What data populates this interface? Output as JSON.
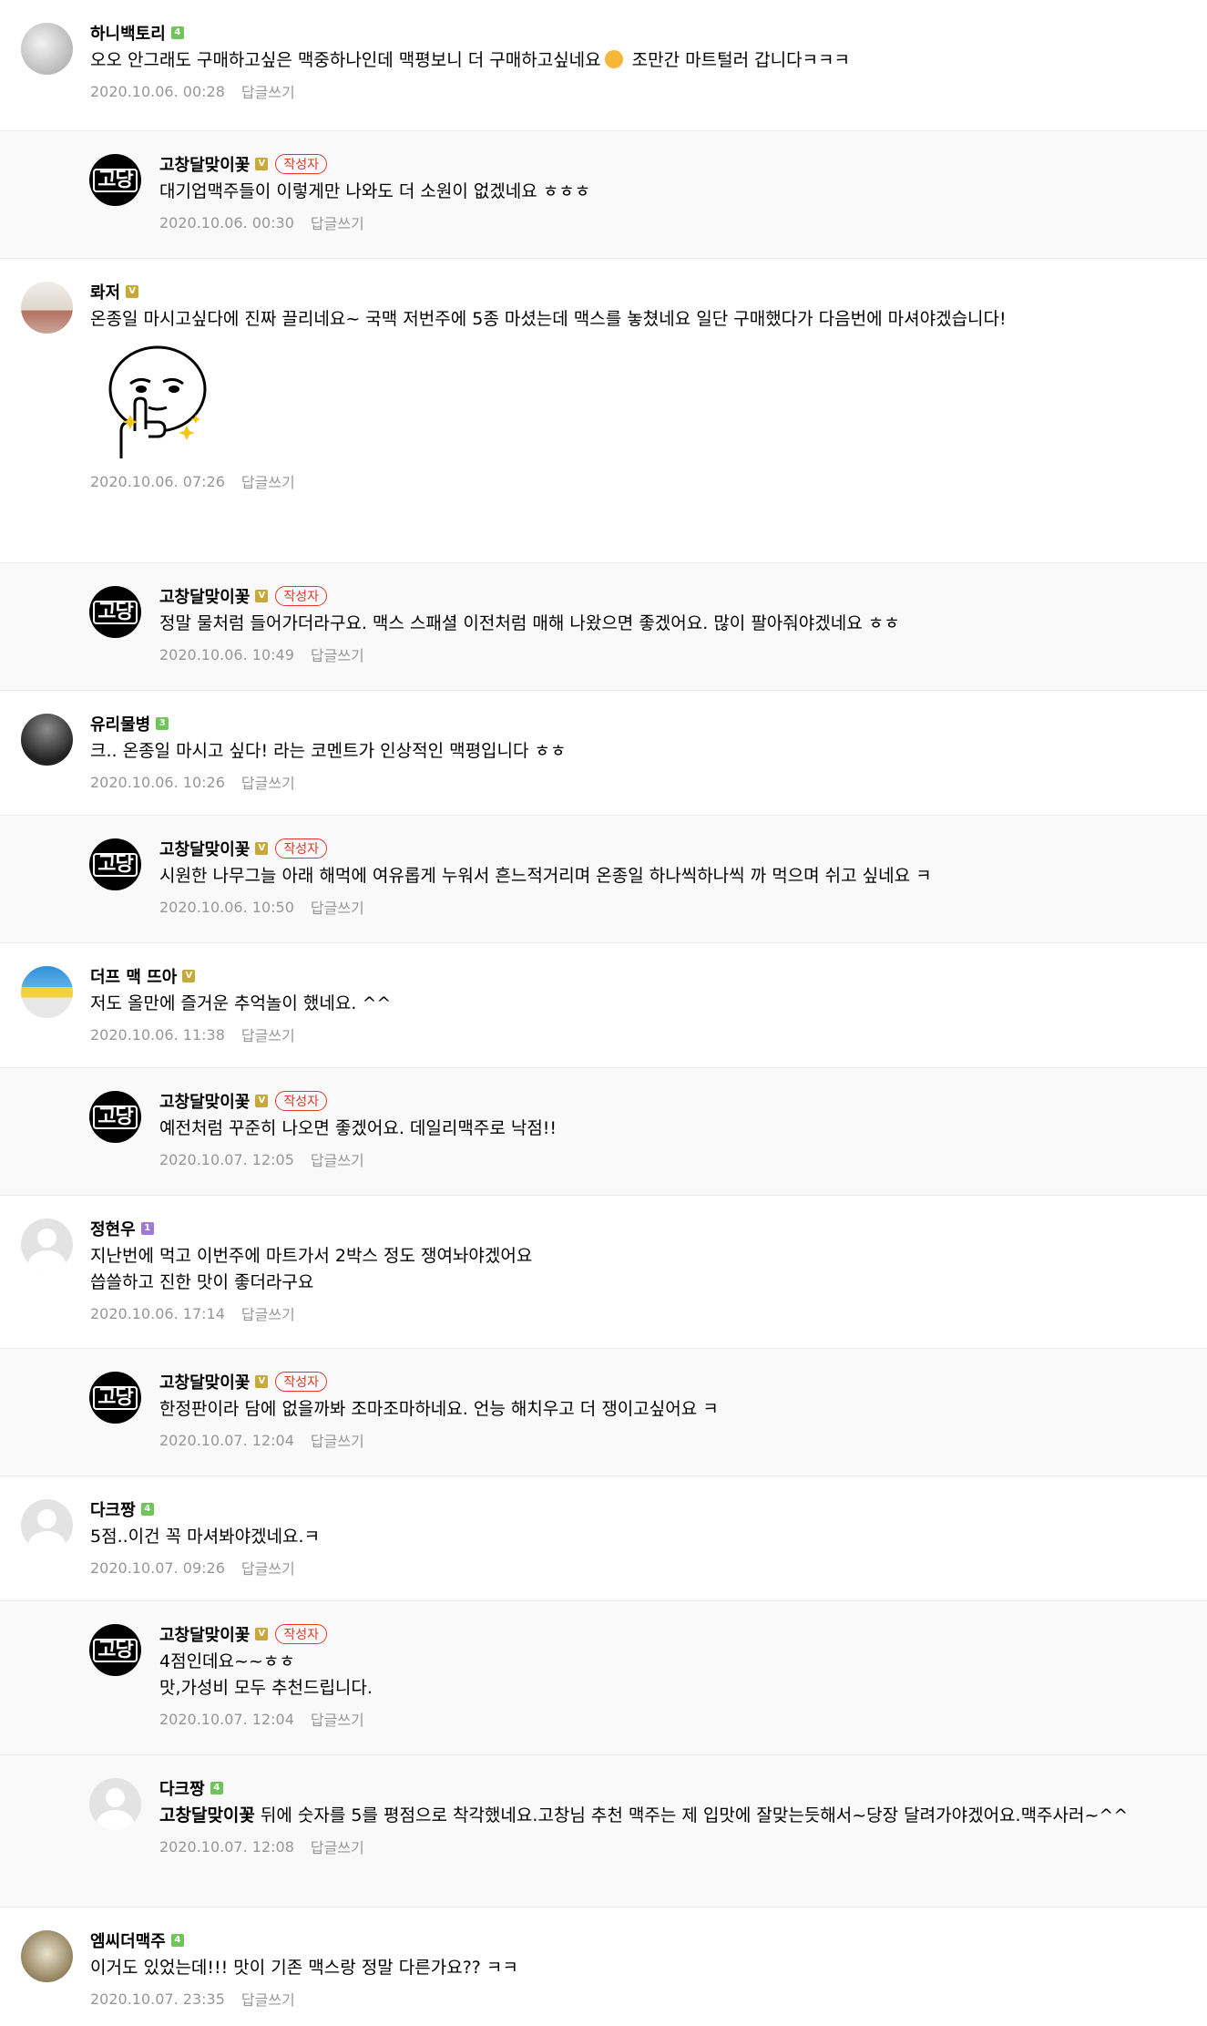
{
  "comments": [
    {
      "type": "top",
      "nick": "하니백토리",
      "level": "4",
      "text": "오오 안그래도 구매하고싶은 맥중하나인데 맥평보니 더 구매하고싶네요",
      "text2": " 조만간 마트털러 갑니다ㅋㅋㅋ",
      "date": "2020.10.06. 00:28"
    },
    {
      "type": "reply",
      "nick": "고창달맞이꽃",
      "level": "V",
      "author": "작성자",
      "text": "대기업맥주들이 이렇게만 나와도 더 소원이 없겠네요 ㅎㅎㅎ",
      "date": "2020.10.06. 00:30"
    },
    {
      "type": "top",
      "nick": "롸저",
      "level": "V",
      "text": "온종일 마시고싶다에 진짜 끌리네요~ 국맥 저번주에 5종 마셨는데 맥스를 놓쳤네요 일단 구매했다가 다음번에 마셔야겠습니다!",
      "date": "2020.10.06. 07:26"
    },
    {
      "type": "reply",
      "nick": "고창달맞이꽃",
      "level": "V",
      "author": "작성자",
      "text": "정말 물처럼 들어가더라구요. 맥스 스패셜 이전처럼 매해 나왔으면 좋겠어요. 많이 팔아줘야겠네요 ㅎㅎ",
      "date": "2020.10.06. 10:49"
    },
    {
      "type": "top",
      "nick": "유리물병",
      "level": "3",
      "text": "크.. 온종일 마시고 싶다! 라는 코멘트가 인상적인 맥평입니다 ㅎㅎ",
      "date": "2020.10.06. 10:26"
    },
    {
      "type": "reply",
      "nick": "고창달맞이꽃",
      "level": "V",
      "author": "작성자",
      "text": "시원한 나무그늘 아래 해먹에 여유롭게 누워서 흔느적거리며 온종일 하나씩하나씩 까 먹으며 쉬고 싶네요 ㅋ",
      "date": "2020.10.06. 10:50"
    },
    {
      "type": "top",
      "nick": "더프 맥 뜨아",
      "level": "V",
      "text": "저도 올만에 즐거운 추억놀이 했네요. ^^",
      "date": "2020.10.06. 11:38"
    },
    {
      "type": "reply",
      "nick": "고창달맞이꽃",
      "level": "V",
      "author": "작성자",
      "text": "예전처럼 꾸준히 나오면 좋겠어요. 데일리맥주로 낙점!!",
      "date": "2020.10.07. 12:05"
    },
    {
      "type": "top",
      "nick": "정현우",
      "level": "1",
      "text": "지난번에 먹고 이번주에 마트가서 2박스 정도 쟁여놔야겠어요\n씁쓸하고 진한 맛이 좋더라구요",
      "date": "2020.10.06. 17:14"
    },
    {
      "type": "reply",
      "nick": "고창달맞이꽃",
      "level": "V",
      "author": "작성자",
      "text": "한정판이라 담에 없을까봐 조마조마하네요. 언능 해치우고 더 쟁이고싶어요 ㅋ",
      "date": "2020.10.07. 12:04"
    },
    {
      "type": "top",
      "nick": "다크짱",
      "level": "4",
      "text": "5점..이건 꼭 마셔봐야겠네요.ㅋ",
      "date": "2020.10.07. 09:26"
    },
    {
      "type": "reply",
      "nick": "고창달맞이꽃",
      "level": "V",
      "author": "작성자",
      "text": "4점인데요~~ㅎㅎ\n맛,가성비 모두 추천드립니다.",
      "date": "2020.10.07. 12:04"
    },
    {
      "type": "reply",
      "nick": "다크짱",
      "level": "4",
      "mention": "고창달맞이꽃",
      "text": " 뒤에 숫자를 5를 평점으로 착각했네요.고창님 추천 맥주는 제 입맛에 잘맞는듯해서~당장 달려가야겠어요.맥주사러~^^",
      "date": "2020.10.07. 12:08"
    },
    {
      "type": "top",
      "nick": "엠씨더맥주",
      "level": "4",
      "text": "이거도 있었는데!!! 맛이 기존 맥스랑 정말 다른가요?? ㅋㅋ",
      "date": "2020.10.07. 23:35"
    }
  ],
  "ui": {
    "reply_label": "답글쓰기",
    "blog_avatar_text": "고당",
    "colors": {
      "author_badge": "#e0392b",
      "meta_gray": "#979797",
      "reply_bg": "#f9f9f9",
      "level_green": "#6fc45a",
      "level_gold": "#c9a83b"
    }
  }
}
